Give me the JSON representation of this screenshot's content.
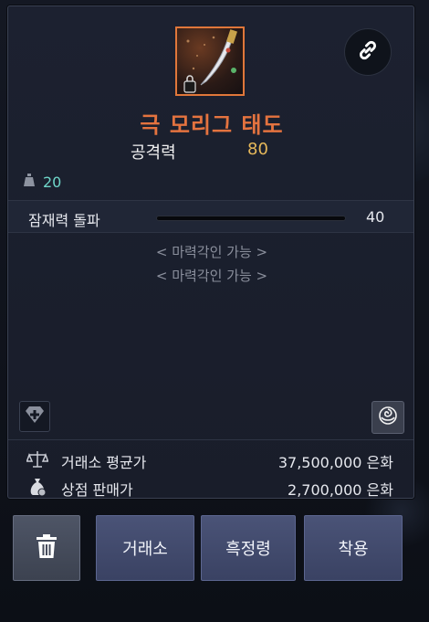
{
  "item": {
    "name": "극 모리그 태도",
    "stat_label": "공격력",
    "stat_value": "80",
    "weight": "20"
  },
  "potential": {
    "label": "잠재력 돌파",
    "value": "40",
    "fill_fraction": 0.0
  },
  "engravings": [
    "< 마력각인 가능 >",
    "< 마력각인 가능 >"
  ],
  "prices": {
    "market_label": "거래소 평균가",
    "market_value": "37,500,000 은화",
    "shop_label": "상점 판매가",
    "shop_value": "2,700,000 은화"
  },
  "buttons": {
    "market": "거래소",
    "black_spirit": "흑정령",
    "equip": "착용"
  },
  "colors": {
    "item_name": "#e4733f",
    "stat_value": "#e6b85a",
    "weight": "#6fd6c9",
    "button_bg": "#434b6e"
  },
  "icons": {
    "link": "link-icon",
    "weight": "weight-icon",
    "gem": "gem-add-icon",
    "rose": "rose-icon",
    "scale": "scale-icon",
    "money_bag": "money-bag-icon",
    "trash": "trash-icon"
  }
}
